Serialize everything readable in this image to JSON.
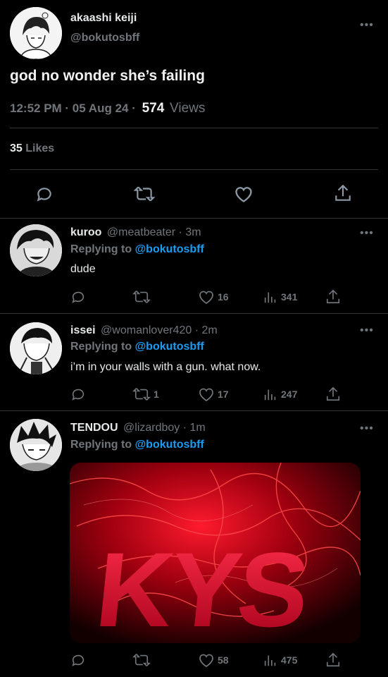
{
  "main_tweet": {
    "display_name": "akaashi keiji",
    "handle": "@bokutosbff",
    "text": "god no wonder she’s failing",
    "time": "12:52 PM · 05 Aug 24 ·",
    "views_count": "574",
    "views_label": "Views",
    "likes_count": "35",
    "likes_label": "Likes",
    "more": "•••"
  },
  "replies": [
    {
      "display_name": "kuroo",
      "handle": "@meatbeater",
      "time": "· 3m",
      "replying_prefix": "Replying to",
      "replying_handle": "@bokutosbff",
      "text": "dude",
      "retweets": "",
      "likes": "16",
      "views": "341",
      "more": "•••"
    },
    {
      "display_name": "issei",
      "handle": "@womanlover420",
      "time": "· 2m",
      "replying_prefix": "Replying to",
      "replying_handle": "@bokutosbff",
      "text": "i’m in your walls with a gun. what now.",
      "retweets": "1",
      "likes": "17",
      "views": "247",
      "more": "•••"
    },
    {
      "display_name": "TENDOU",
      "handle": "@lizardboy",
      "time": "· 1m",
      "replying_prefix": "Replying to",
      "replying_handle": "@bokutosbff",
      "media_text": "KYS",
      "retweets": "",
      "likes": "58",
      "views": "475",
      "more": "•••"
    }
  ],
  "colors": {
    "background": "#000000",
    "text": "#e7e9ea",
    "secondary": "#71767b",
    "link": "#1d9bf0",
    "divider": "#2f3336",
    "media_red": "#e0112b"
  },
  "icons": [
    "reply-icon",
    "retweet-icon",
    "like-icon",
    "views-icon",
    "share-icon",
    "more-icon"
  ]
}
